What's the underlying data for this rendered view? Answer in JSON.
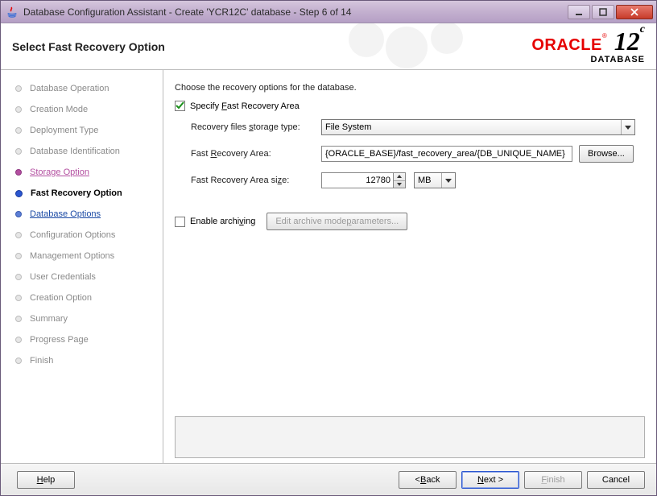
{
  "window": {
    "title": "Database Configuration Assistant - Create 'YCR12C' database - Step 6 of 14"
  },
  "header": {
    "section_title": "Select Fast Recovery Option",
    "brand_line1": "ORACLE",
    "brand_line2": "DATABASE",
    "brand_version": "12",
    "brand_suffix": "c"
  },
  "steps": [
    {
      "label": "Database Operation",
      "state": "past"
    },
    {
      "label": "Creation Mode",
      "state": "past"
    },
    {
      "label": "Deployment Type",
      "state": "past"
    },
    {
      "label": "Database Identification",
      "state": "past"
    },
    {
      "label": "Storage Option",
      "state": "visited"
    },
    {
      "label": "Fast Recovery Option",
      "state": "current"
    },
    {
      "label": "Database Options",
      "state": "link"
    },
    {
      "label": "Configuration Options",
      "state": "future"
    },
    {
      "label": "Management Options",
      "state": "future"
    },
    {
      "label": "User Credentials",
      "state": "future"
    },
    {
      "label": "Creation Option",
      "state": "future"
    },
    {
      "label": "Summary",
      "state": "future"
    },
    {
      "label": "Progress Page",
      "state": "future"
    },
    {
      "label": "Finish",
      "state": "future"
    }
  ],
  "content": {
    "instruction": "Choose the recovery options for the database.",
    "specify_fra_label": "Specify Fast Recovery Area",
    "specify_fra_checked": true,
    "storage_type_label": "Recovery files storage type:",
    "storage_type_value": "File System",
    "fra_label": "Fast Recovery Area:",
    "fra_value": "{ORACLE_BASE}/fast_recovery_area/{DB_UNIQUE_NAME}",
    "browse_label": "Browse...",
    "fra_size_label": "Fast Recovery Area size:",
    "fra_size_value": "12780",
    "fra_size_unit": "MB",
    "enable_archiving_label": "Enable archiving",
    "enable_archiving_checked": false,
    "edit_archive_button": "Edit archive mode parameters..."
  },
  "footer": {
    "help": "Help",
    "back": " Back",
    "next": "Next ",
    "finish": "Finish",
    "cancel": "Cancel"
  }
}
